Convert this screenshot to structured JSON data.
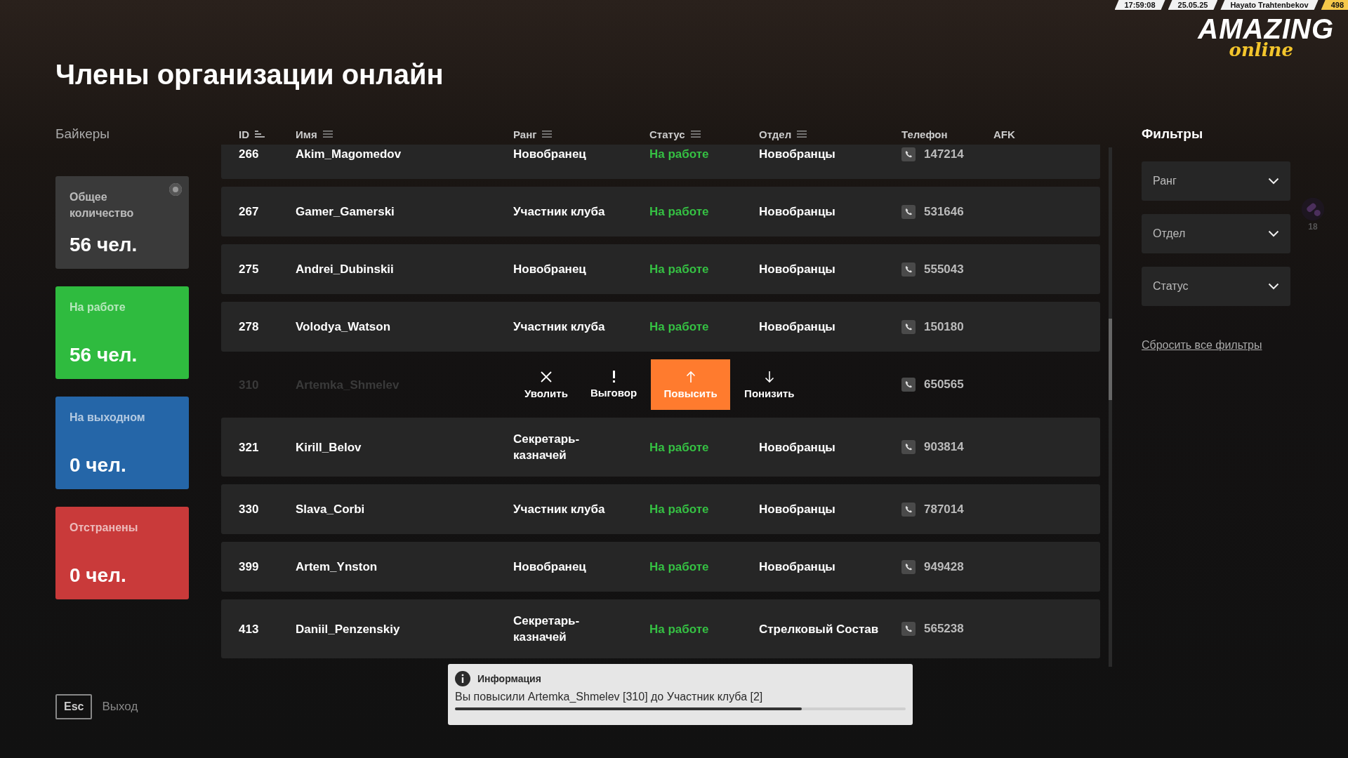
{
  "hud": {
    "time": "17:59:08",
    "date": "25.05.25",
    "player": "Hayato Trahtenbekov",
    "score": "498",
    "logo_main": "AMAZING",
    "logo_sub": "online",
    "counter": "18"
  },
  "title": "Члены организации онлайн",
  "organization": "Байкеры",
  "stats": [
    {
      "label": "Общее количество",
      "value": "56 чел.",
      "color": "#3a3a3a",
      "indicator": true
    },
    {
      "label": "На работе",
      "value": "56 чел.",
      "color": "#2fbb3f",
      "indicator": false
    },
    {
      "label": "На выходном",
      "value": "0 чел.",
      "color": "#2566a8",
      "indicator": false
    },
    {
      "label": "Отстранены",
      "value": "0 чел.",
      "color": "#c93a3a",
      "indicator": false
    }
  ],
  "table": {
    "columns": [
      {
        "label": "ID",
        "kind": "sort"
      },
      {
        "label": "Имя",
        "kind": "filter"
      },
      {
        "label": "Ранг",
        "kind": "filter"
      },
      {
        "label": "Статус",
        "kind": "filter"
      },
      {
        "label": "Отдел",
        "kind": "filter"
      },
      {
        "label": "Телефон",
        "kind": "plain"
      },
      {
        "label": "AFK",
        "kind": "plain"
      }
    ],
    "rows": [
      {
        "id": "266",
        "name": "Akim_Magomedov",
        "rank": "Новобранец",
        "status": "На работе",
        "department": "Новобранцы",
        "phone": "147214",
        "actions_open": false
      },
      {
        "id": "267",
        "name": "Gamer_Gamerski",
        "rank": "Участник клуба",
        "status": "На работе",
        "department": "Новобранцы",
        "phone": "531646",
        "actions_open": false
      },
      {
        "id": "275",
        "name": "Andrei_Dubinskii",
        "rank": "Новобранец",
        "status": "На работе",
        "department": "Новобранцы",
        "phone": "555043",
        "actions_open": false
      },
      {
        "id": "278",
        "name": "Volodya_Watson",
        "rank": "Участник клуба",
        "status": "На работе",
        "department": "Новобранцы",
        "phone": "150180",
        "actions_open": false
      },
      {
        "id": "310",
        "name": "Artemka_Shmelev",
        "phone": "650565",
        "actions_open": true
      },
      {
        "id": "321",
        "name": "Kirill_Belov",
        "rank": "Секретарь-казначей",
        "status": "На работе",
        "department": "Новобранцы",
        "phone": "903814",
        "actions_open": false
      },
      {
        "id": "330",
        "name": "Slava_Corbi",
        "rank": "Участник клуба",
        "status": "На работе",
        "department": "Новобранцы",
        "phone": "787014",
        "actions_open": false
      },
      {
        "id": "399",
        "name": "Artem_Ynston",
        "rank": "Новобранец",
        "status": "На работе",
        "department": "Новобранцы",
        "phone": "949428",
        "actions_open": false
      },
      {
        "id": "413",
        "name": "Daniil_Penzenskiy",
        "rank": "Секретарь-казначей",
        "status": "На работе",
        "department": "Стрелковый Состав",
        "phone": "565238",
        "actions_open": false
      }
    ]
  },
  "actions": [
    {
      "label": "Уволить",
      "kind": "fire",
      "selected": false
    },
    {
      "label": "Выговор",
      "kind": "reprimand",
      "selected": false
    },
    {
      "label": "Повысить",
      "kind": "promote",
      "selected": true
    },
    {
      "label": "Понизить",
      "kind": "demote",
      "selected": false
    }
  ],
  "filters": {
    "title": "Фильтры",
    "dropdowns": [
      "Ранг",
      "Отдел",
      "Статус"
    ],
    "reset": "Сбросить все фильтры"
  },
  "exit": {
    "key": "Esc",
    "label": "Выход"
  },
  "notification": {
    "title": "Информация",
    "message": "Вы повысили Artemka_Shmelev [310] до Участник клуба [2]",
    "level": 0.77
  }
}
